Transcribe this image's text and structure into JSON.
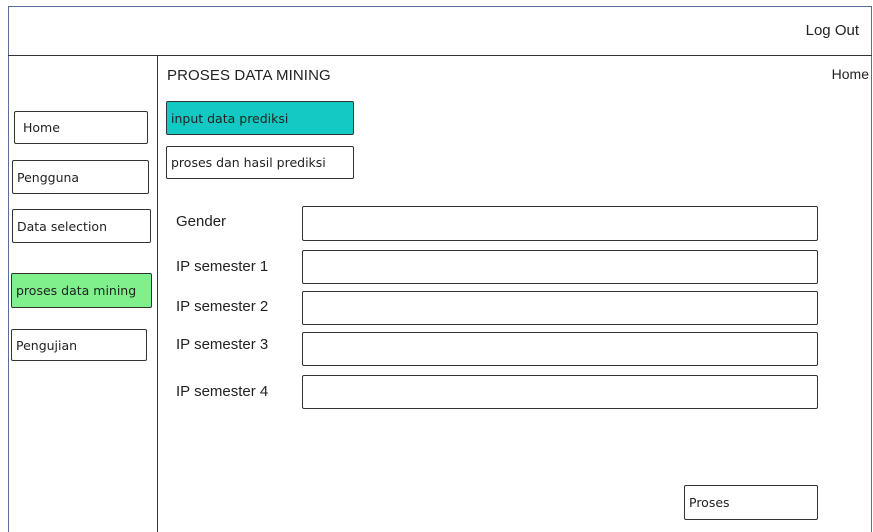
{
  "header": {
    "logout_label": "Log Out"
  },
  "breadcrumb": {
    "home_label": "Home"
  },
  "page": {
    "title": "PROSES DATA MINING"
  },
  "sidebar": {
    "items": [
      {
        "label": "Home"
      },
      {
        "label": "Pengguna"
      },
      {
        "label": "Data selection"
      },
      {
        "label": "proses data mining",
        "active": true,
        "color": "#80f08c"
      },
      {
        "label": "Pengujian"
      }
    ]
  },
  "tabs": [
    {
      "label": "input data prediksi",
      "active": true,
      "color": "#14c9c4"
    },
    {
      "label": "proses dan hasil prediksi"
    }
  ],
  "form": {
    "fields": [
      {
        "label": "Gender",
        "value": ""
      },
      {
        "label": "IP semester 1",
        "value": ""
      },
      {
        "label": "IP semester 2",
        "value": ""
      },
      {
        "label": "IP semester 3",
        "value": ""
      },
      {
        "label": "IP semester 4",
        "value": ""
      }
    ],
    "submit_label": "Proses"
  }
}
